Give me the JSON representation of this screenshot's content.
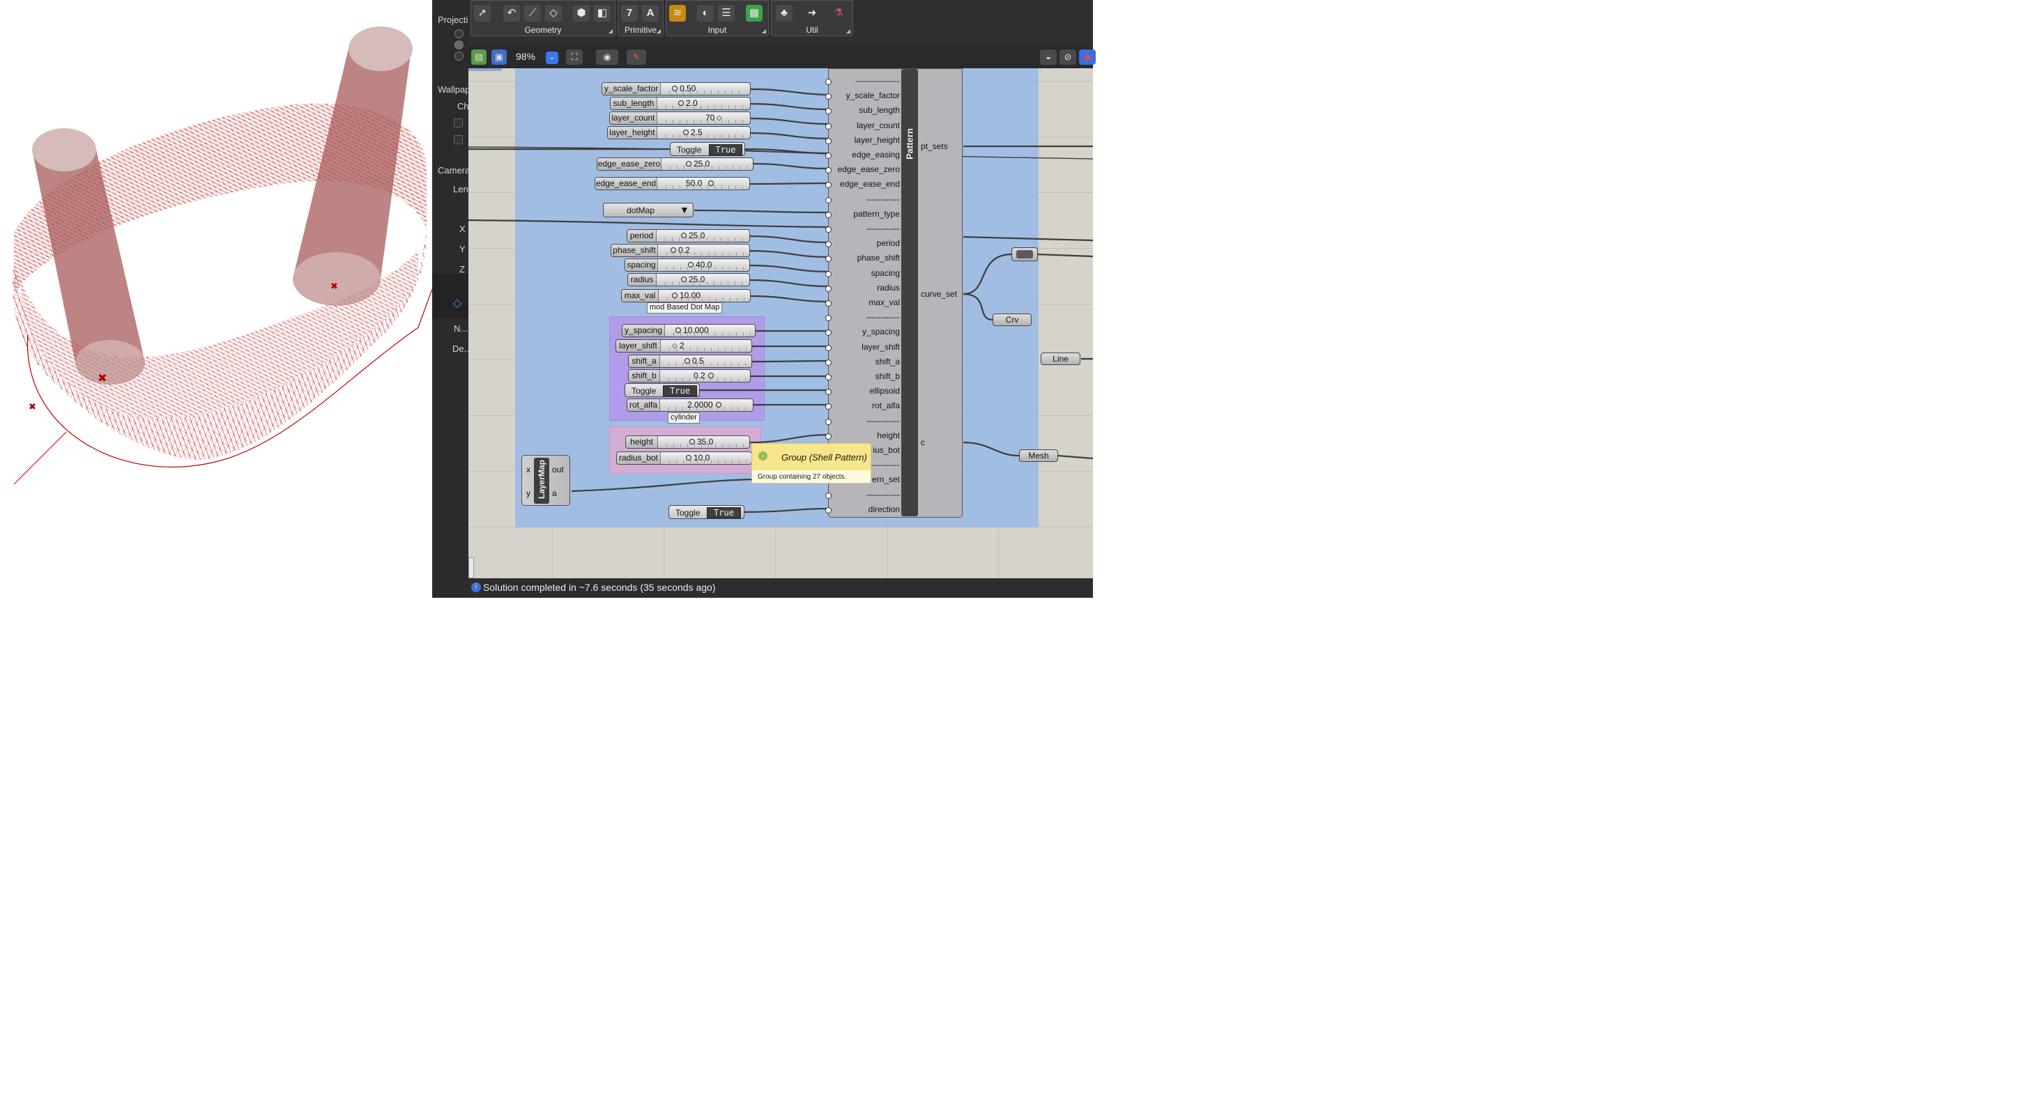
{
  "rhino_panel": {
    "projection": "Projecti",
    "wallpaper": "Wallpap",
    "ch": "Ch",
    "camera": "Camera",
    "lens": "Len",
    "x": "X",
    "y": "Y",
    "z": "Z",
    "name": "N...",
    "details": "De..."
  },
  "toolbar": {
    "groups": [
      "Geometry",
      "Primitive",
      "Input",
      "Util"
    ],
    "primitive_icons": [
      "7",
      "A"
    ]
  },
  "canvas_bar": {
    "zoom": "98%"
  },
  "sliders_top": [
    {
      "label": "y_scale_factor",
      "value": "0.50"
    },
    {
      "label": "sub_length",
      "value": "2.0"
    },
    {
      "label": "layer_count",
      "value": "70"
    },
    {
      "label": "layer_height",
      "value": "2.5"
    }
  ],
  "toggle_edge": {
    "label": "Toggle",
    "value": "True"
  },
  "edge_sliders": [
    {
      "label": "edge_ease_zero",
      "value": "25.0"
    },
    {
      "label": "edge_ease_end",
      "value": "50.0"
    }
  ],
  "dotmap": {
    "label": "dotMap"
  },
  "pattern_sliders": [
    {
      "label": "period",
      "value": "25.0"
    },
    {
      "label": "phase_shift",
      "value": "0.2"
    },
    {
      "label": "spacing",
      "value": "40.0"
    },
    {
      "label": "radius",
      "value": "25.0"
    },
    {
      "label": "max_val",
      "value": "10.00"
    }
  ],
  "group_modbased": {
    "label": "mod Based Dot Map"
  },
  "purple_sliders": [
    {
      "label": "y_spacing",
      "value": "10.000"
    },
    {
      "label": "layer_shift",
      "value": "2"
    },
    {
      "label": "shift_a",
      "value": "0.5"
    },
    {
      "label": "shift_b",
      "value": "0.2"
    }
  ],
  "toggle_purple": {
    "label": "Toggle",
    "value": "True"
  },
  "rot_alfa": {
    "label": "rot_alfa",
    "value": "2.0000"
  },
  "group_cylinder": {
    "label": "cylinder"
  },
  "cyl_sliders": [
    {
      "label": "height",
      "value": "35.0"
    },
    {
      "label": "radius_bot",
      "value": "10.0"
    }
  ],
  "toggle_bottom": {
    "label": "Toggle",
    "value": "True"
  },
  "layermap": {
    "title": "LayerMap",
    "in_x": "x",
    "in_y": "y",
    "out_out": "out",
    "out_a": "a"
  },
  "pattern": {
    "title": "Pattern",
    "inputs": [
      "----------------",
      "y_scale_factor",
      "sub_length",
      "layer_count",
      "layer_height",
      "edge_easing",
      "edge_ease_zero",
      "edge_ease_end",
      "------------",
      "pattern_type",
      "------------",
      "period",
      "phase_shift",
      "spacing",
      "radius",
      "max_val",
      "------------",
      "y_spacing",
      "layer_shift",
      "shift_a",
      "shift_b",
      "ellipsoid",
      "rot_alfa",
      "------------",
      "height",
      "ius_bot",
      "------------",
      "ern_set",
      "------------",
      "direction"
    ],
    "outputs": [
      "pt_sets",
      "curve_set",
      "c"
    ]
  },
  "nodes": {
    "crv": "Crv",
    "line": "Line",
    "mesh": "Mesh"
  },
  "tooltip": {
    "title": "Group (Shell Pattern)",
    "body": "Group containing 27 objects."
  },
  "status": {
    "text": "Solution completed in ~7.6 seconds (35 seconds ago)"
  }
}
